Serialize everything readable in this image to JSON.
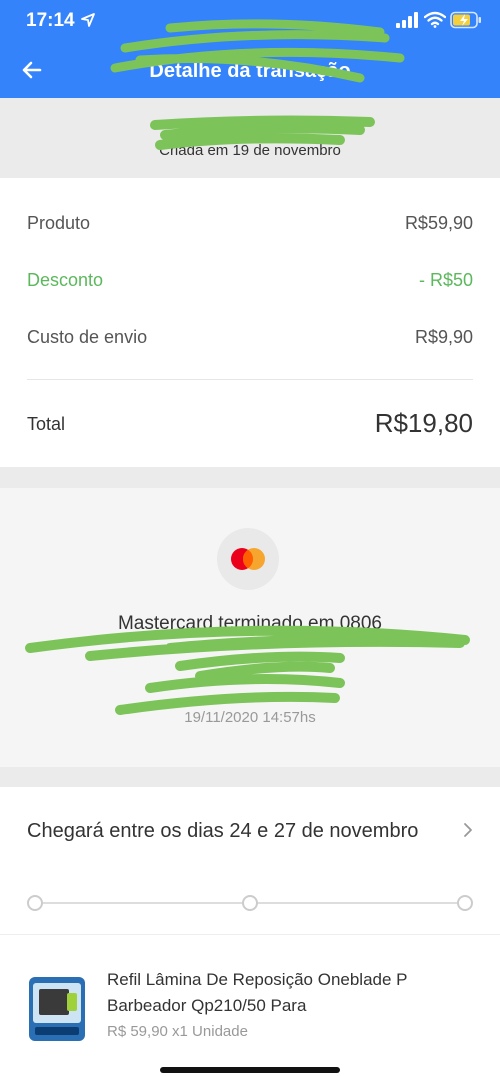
{
  "status_bar": {
    "time": "17:14"
  },
  "header": {
    "title": "Detalhe da transação",
    "accent_color": "#3483fa"
  },
  "summary": {
    "created": "Criada em 19 de novembro"
  },
  "breakdown": {
    "product_label": "Produto",
    "product_value": "R$59,90",
    "discount_label": "Desconto",
    "discount_value": "- R$50",
    "shipping_label": "Custo de envio",
    "shipping_value": "R$9,90",
    "total_label": "Total",
    "total_value": "R$19,80"
  },
  "payment": {
    "card_icon": "mastercard-icon",
    "card_name": "Mastercard terminado em 0806",
    "date": "19/11/2020 14:57hs"
  },
  "delivery": {
    "text": "Chegará entre os dias 24 e 27 de novembro",
    "progress_steps": 3,
    "current_step": 0
  },
  "product": {
    "title": "Refil Lâmina De Reposição Oneblade P Barbeador Qp210/50 Para",
    "meta": "R$ 59,90 x1 Unidade"
  },
  "colors": {
    "discount": "#5cb85c",
    "redaction": "#7cc45a"
  }
}
